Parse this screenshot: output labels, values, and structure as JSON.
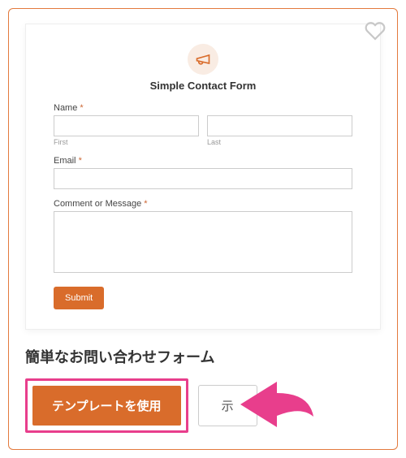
{
  "preview": {
    "title": "Simple Contact Form",
    "name_label": "Name",
    "first_sublabel": "First",
    "last_sublabel": "Last",
    "email_label": "Email",
    "comment_label": "Comment or Message",
    "required_mark": "*",
    "submit_label": "Submit"
  },
  "card": {
    "title": "簡単なお問い合わせフォーム",
    "use_template_label": "テンプレートを使用",
    "secondary_label": "示"
  }
}
